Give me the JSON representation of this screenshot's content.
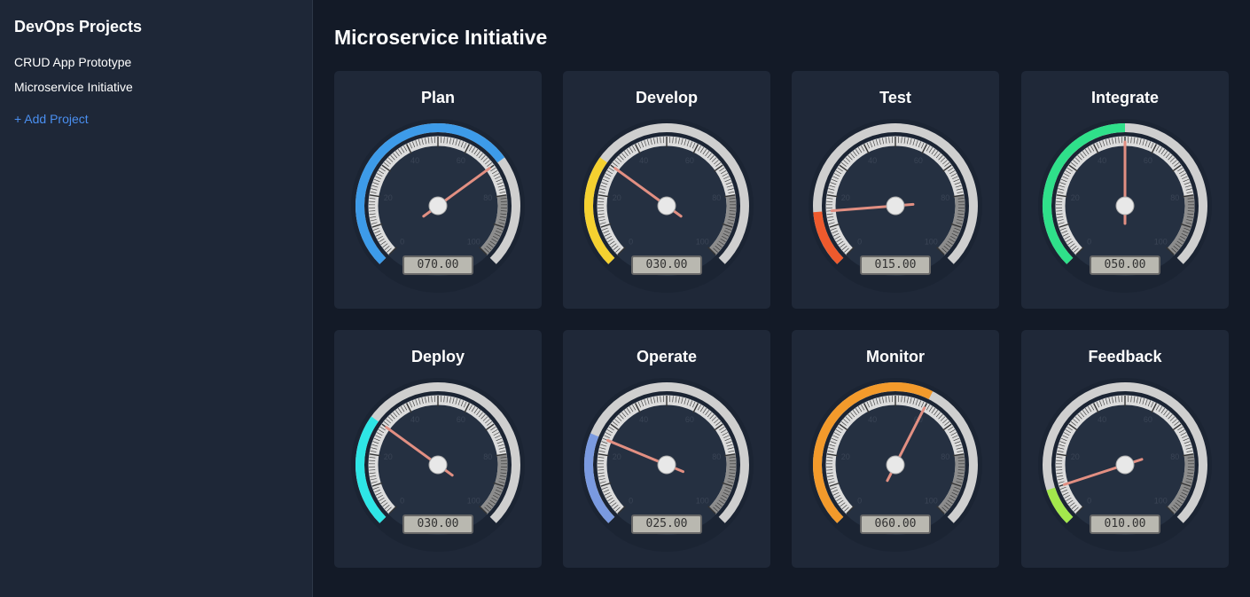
{
  "sidebar": {
    "title": "DevOps Projects",
    "projects": [
      "CRUD App Prototype",
      "Microservice Initiative"
    ],
    "add_label": "+ Add Project"
  },
  "main": {
    "title": "Microservice Initiative",
    "gauges": [
      {
        "name": "Plan",
        "value": 70,
        "display": "070.00",
        "color": "#3d9be9"
      },
      {
        "name": "Develop",
        "value": 30,
        "display": "030.00",
        "color": "#f5d130"
      },
      {
        "name": "Test",
        "value": 15,
        "display": "015.00",
        "color": "#ee5a2d"
      },
      {
        "name": "Integrate",
        "value": 50,
        "display": "050.00",
        "color": "#2fe08a"
      },
      {
        "name": "Deploy",
        "value": 30,
        "display": "030.00",
        "color": "#2ee6e6"
      },
      {
        "name": "Operate",
        "value": 25,
        "display": "025.00",
        "color": "#7a9ae0"
      },
      {
        "name": "Monitor",
        "value": 60,
        "display": "060.00",
        "color": "#f39a2b"
      },
      {
        "name": "Feedback",
        "value": 10,
        "display": "010.00",
        "color": "#a3e84c"
      }
    ],
    "scale_labels": [
      "0",
      "20",
      "40",
      "60",
      "80",
      "100"
    ]
  }
}
